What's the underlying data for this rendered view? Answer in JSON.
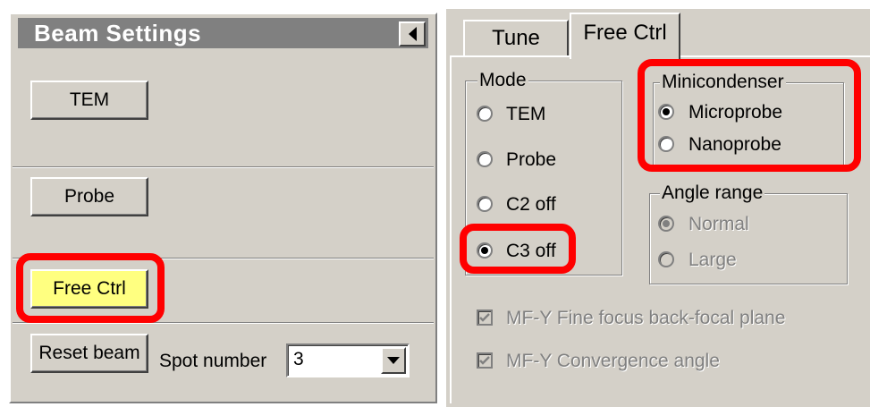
{
  "beam_settings": {
    "title": "Beam Settings",
    "collapse_icon": "triangle-left-icon",
    "buttons": {
      "tem": "TEM",
      "probe": "Probe",
      "free_ctrl": "Free Ctrl",
      "reset_beam": "Reset beam"
    },
    "spot_number_label": "Spot number",
    "spot_number_value": "3",
    "free_ctrl_color": "#ffff80"
  },
  "tabs": {
    "tune": "Tune",
    "free_ctrl": "Free Ctrl",
    "active": "Free Ctrl"
  },
  "mode": {
    "legend": "Mode",
    "options": [
      "TEM",
      "Probe",
      "C2 off",
      "C3 off"
    ],
    "selected": "C3 off"
  },
  "minicondenser": {
    "legend": "Minicondenser",
    "options": [
      "Microprobe",
      "Nanoprobe"
    ],
    "selected": "Microprobe"
  },
  "angle_range": {
    "legend": "Angle range",
    "options": [
      "Normal",
      "Large"
    ],
    "selected": "Normal",
    "disabled": true
  },
  "checkboxes": {
    "mfy_fine_focus": "MF-Y Fine focus back-focal plane",
    "mfy_convergence": "MF-Y Convergence angle"
  },
  "highlight_color": "#ff0000"
}
